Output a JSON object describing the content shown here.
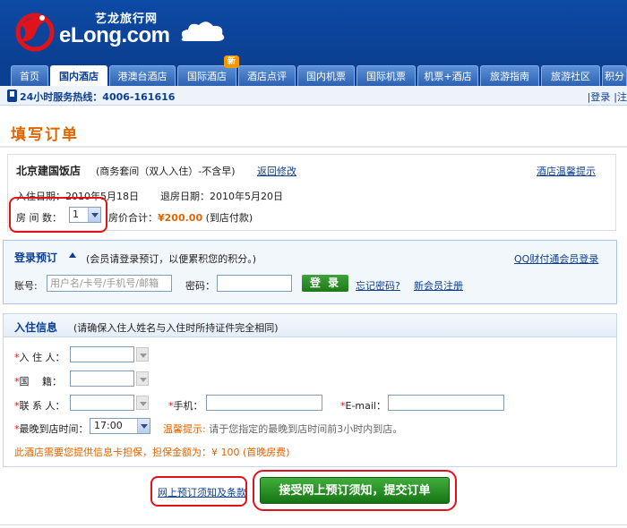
{
  "header": {
    "logo_cn": "艺龙旅行网",
    "logo_en": "eLong.com"
  },
  "nav": {
    "tabs": [
      {
        "label": "首页"
      },
      {
        "label": "国内酒店"
      },
      {
        "label": "港澳台酒店"
      },
      {
        "label": "国际酒店"
      },
      {
        "label": "酒店点评"
      },
      {
        "label": "国内机票"
      },
      {
        "label": "国际机票"
      },
      {
        "label": "机票+酒店"
      },
      {
        "label": "旅游指南"
      },
      {
        "label": "旅游社区"
      },
      {
        "label": "积分"
      }
    ],
    "new_badge": "新"
  },
  "hotline": {
    "text": "24小时服务热线：4006-161616",
    "links": [
      "|登录",
      "|注"
    ]
  },
  "page_title": "填写订单",
  "hotel": {
    "name": "北京建国饭店",
    "room_type": "(商务套间（双人入住）-不含早)",
    "back_link": "返回修改",
    "tips_link": "酒店温馨提示",
    "checkin": "入住日期：2010年5月18日",
    "checkout": "退房日期：2010年5月20日",
    "rooms_label": "房 间 数：",
    "rooms_value": "1",
    "price_label": "房价合计：",
    "price_value": "¥200.00",
    "price_note": "(到店付款)"
  },
  "login": {
    "title": "登录预订",
    "note": "(会员请登录预订，以便累积您的积分。)",
    "qq_link": "QQ财付通会员登录",
    "account_label": "账号:",
    "account_placeholder": "用户名/卡号/手机号/邮箱",
    "password_label": "密码：",
    "login_button": "登 录",
    "forgot_link": "忘记密码?",
    "register_link": "新会员注册"
  },
  "guest": {
    "title": "入住信息",
    "note": "(请确保入住人姓名与入住时所持证件完全相同)",
    "req_mark": "*",
    "name_label": "入 住 人：",
    "nationality_label": "国　 籍：",
    "contact_label": "联 系 人：",
    "mobile_label": "手机：",
    "email_label": "E-mail：",
    "arrival_label": "最晚到店时间：",
    "arrival_value": "17:00",
    "warm_label": "温馨提示:",
    "warm_text": "请于您指定的最晚到店时间前3小时内到店。",
    "guarantee": "此酒店需要您提供信息卡担保，担保金额为：¥ 100 (首晚房费)"
  },
  "actions": {
    "terms_link": "网上预订须知及条款",
    "submit": "接受网上预订须知，提交订单"
  },
  "colors": {
    "brand_blue": "#0b3f91",
    "accent_orange": "#e06500",
    "button_green": "#1c7a18",
    "highlight_red": "#e0131a"
  }
}
